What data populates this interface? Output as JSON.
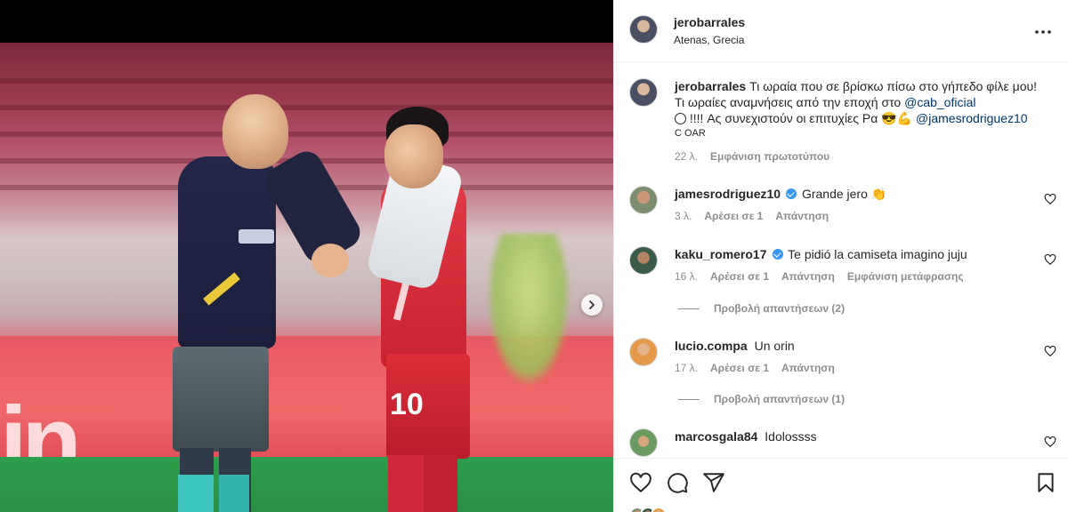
{
  "post": {
    "username": "jerobarrales",
    "location": "Atenas, Grecia",
    "image_ad_text": "in",
    "player_number": "10"
  },
  "caption": {
    "username": "jerobarrales",
    "text_1": "Τι ωραία που σε βρίσκω πίσω στο γήπεδο φίλε μου! Τι ωραίες αναμνήσεις από την εποχή στο ",
    "mention_1": "@cab_oficial",
    "text_2": " !!!! Ας συνεχιστούν οι επιτυχίες Ρα ",
    "mention_2": "@jamesrodriguez10",
    "text_3": "C OAR",
    "time": "22 λ.",
    "see_translation": "Εμφάνιση πρωτοτύπου"
  },
  "comments": [
    {
      "username": "jamesrodriguez10",
      "verified": true,
      "text": "Grande jero",
      "emoji": "👏",
      "time": "3 λ.",
      "likes": "Αρέσει σε 1",
      "reply": "Απάντηση"
    },
    {
      "username": "kaku_romero17",
      "verified": true,
      "text": "Te pidió la camiseta imagino juju",
      "time": "16 λ.",
      "likes": "Αρέσει σε 1",
      "reply": "Απάντηση",
      "translate": "Εμφάνιση μετάφρασης",
      "view_replies": "Προβολή απαντήσεων (2)"
    },
    {
      "username": "lucio.compa",
      "text": "Un orin",
      "time": "17 λ.",
      "likes": "Αρέσει σε 1",
      "reply": "Απάντηση",
      "view_replies": "Προβολή απαντήσεων (1)"
    },
    {
      "username": "marcosgala84",
      "text": "Idolossss"
    }
  ],
  "icons": {
    "more": "more-options-icon",
    "next": "chevron-right-icon",
    "heart": "heart-icon",
    "comment": "comment-icon",
    "share": "share-icon",
    "save": "bookmark-icon"
  },
  "colors": {
    "link": "#00376b",
    "verified": "#3897f0",
    "muted": "#8e8e8e",
    "text": "#262626"
  }
}
